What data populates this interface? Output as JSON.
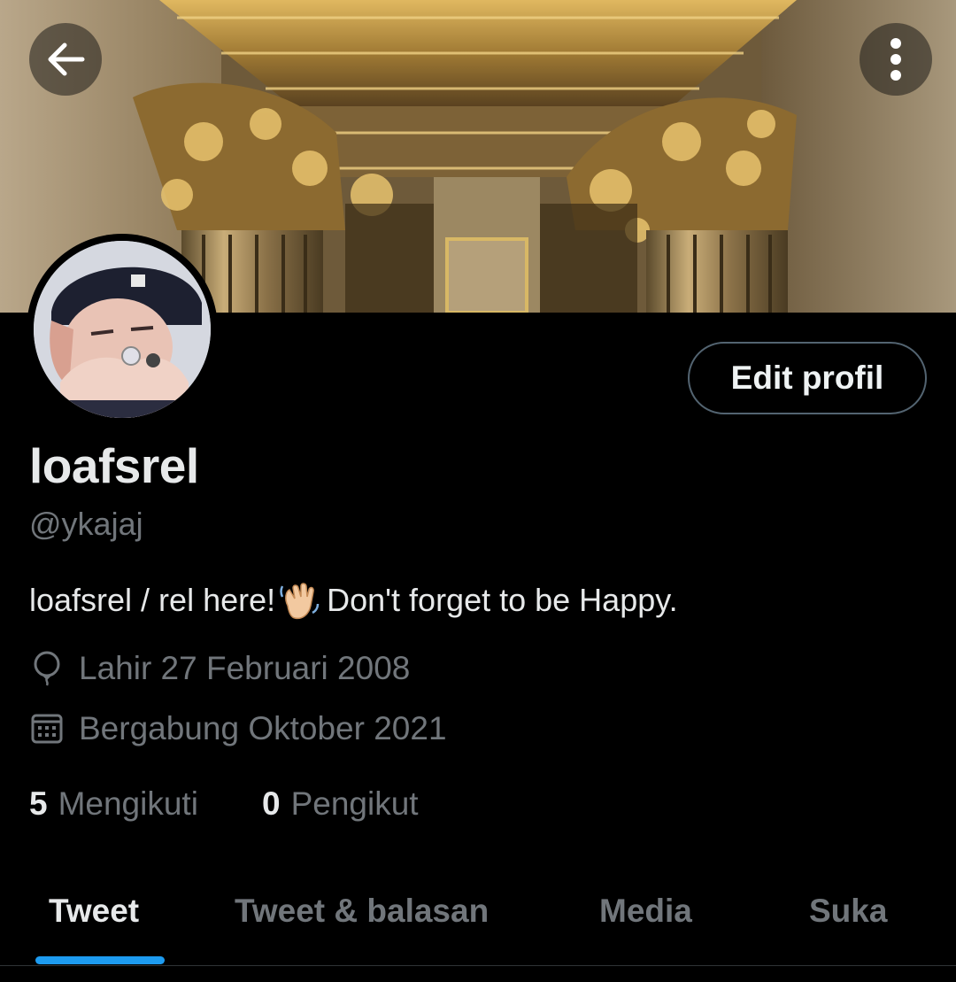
{
  "header": {
    "back_icon": "arrow-left-icon",
    "more_icon": "more-vertical-icon"
  },
  "profile": {
    "edit_button_label": "Edit profil",
    "display_name": "loafsrel",
    "handle": "@ykajaj",
    "bio_before": "loafsrel / rel here!",
    "bio_emoji": "waving-hand",
    "bio_after": "Don't forget to be Happy.",
    "birth_icon": "balloon-icon",
    "birth_text": "Lahir 27 Februari 2008",
    "join_icon": "calendar-icon",
    "join_text": "Bergabung Oktober 2021",
    "following_count": "5",
    "following_label": "Mengikuti",
    "followers_count": "0",
    "followers_label": "Pengikut"
  },
  "tabs": [
    {
      "label": "Tweet",
      "active": true
    },
    {
      "label": "Tweet & balasan",
      "active": false
    },
    {
      "label": "Media",
      "active": false
    },
    {
      "label": "Suka",
      "active": false
    }
  ],
  "colors": {
    "background": "#000000",
    "accent": "#1d9bf0",
    "muted_text": "#71767b",
    "primary_text": "#e7e9ea"
  }
}
